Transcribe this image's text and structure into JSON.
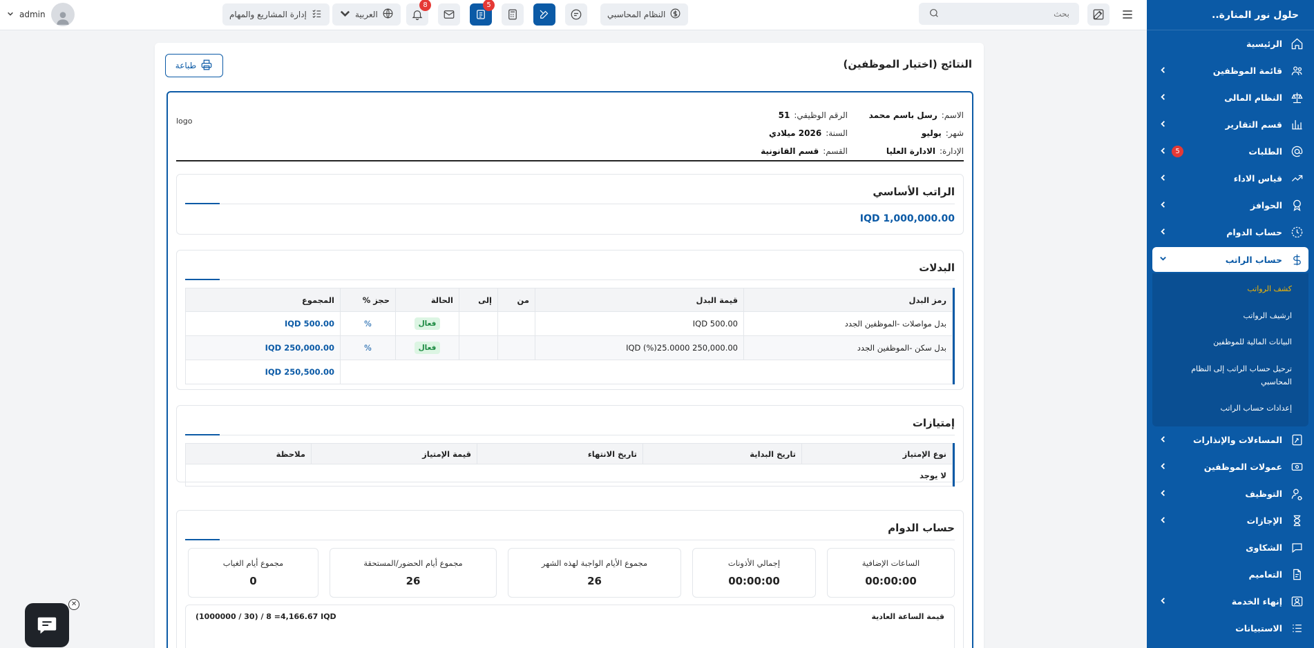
{
  "sidebar": {
    "brand": "حلول نور المنارة..",
    "items": [
      {
        "label": "الرئيسية",
        "icon": "home-icon",
        "chevron": false
      },
      {
        "label": "قائمة الموظفين",
        "icon": "users-icon",
        "chevron": true
      },
      {
        "label": "النظام المالى",
        "icon": "scale-icon",
        "chevron": true
      },
      {
        "label": "قسم التقارير",
        "icon": "chart-icon",
        "chevron": true
      },
      {
        "label": "الطلبات",
        "icon": "at-icon",
        "chevron": true,
        "badge": "5"
      },
      {
        "label": "قياس الاداء",
        "icon": "trend-icon",
        "chevron": true
      },
      {
        "label": "الحوافز",
        "icon": "award-icon",
        "chevron": true
      },
      {
        "label": "حساب الدوام",
        "icon": "clock-icon",
        "chevron": true
      }
    ],
    "active": {
      "label": "حساب الراتب",
      "icon": "dollar-icon"
    },
    "subitems": [
      "كشف الرواتب",
      "ارشيف الرواتب",
      "البيانات المالية للموظفين",
      "ترحيل حساب الراتب إلى النظام المحاسبي",
      "إعدادات حساب الراتب"
    ],
    "items_after": [
      {
        "label": "المساءلات والإنذارات",
        "icon": "gavel-icon",
        "chevron": true
      },
      {
        "label": "عمولات الموظفين",
        "icon": "cash-icon",
        "chevron": true
      },
      {
        "label": "التوظيف",
        "icon": "user-search-icon",
        "chevron": true
      },
      {
        "label": "الإجازات",
        "icon": "hourglass-icon",
        "chevron": true
      },
      {
        "label": "الشكاوى",
        "icon": "chat-icon",
        "chevron": false
      },
      {
        "label": "التعاميم",
        "icon": "doc-icon",
        "chevron": false
      },
      {
        "label": "إنهاء الخدمة",
        "icon": "user-x-icon",
        "chevron": true
      },
      {
        "label": "الاستبيانات",
        "icon": "list-icon",
        "chevron": false
      }
    ]
  },
  "topbar": {
    "search_placeholder": "بحث",
    "accounting_label": "النظام المحاسبي",
    "language_label": "العربية",
    "projects_label": "إدارة المشاريع والمهام",
    "user_name": "admin",
    "notif_count": "8",
    "tasks_count": "5"
  },
  "page": {
    "title": "النتائج (اختيار الموظفين)",
    "print_label": "طباعة"
  },
  "employee": {
    "name_label": "الاسم:",
    "name": "رسل باسم محمد",
    "id_label": "الرقم الوظيفي:",
    "id": "51",
    "month_label": "شهر:",
    "month": "يوليو",
    "year_label": "السنة:",
    "year": "2026 ميلادي",
    "admin_label": "الإدارة:",
    "admin": "الادارة العليا",
    "dept_label": "القسم:",
    "dept": "قسم القانونية",
    "logo_alt": "logo"
  },
  "basic_salary": {
    "title": "الراتب الأساسي",
    "amount": "1,000,000.00 IQD"
  },
  "allowances": {
    "title": "البدلات",
    "headers": [
      "رمز البدل",
      "قيمة البدل",
      "من",
      "إلى",
      "الحالة",
      "حجز %",
      "المجموع"
    ],
    "rows": [
      {
        "code": "بدل مواصلات -الموظفين الجدد",
        "value": "500.00 IQD",
        "from": "",
        "to": "",
        "status": "فعال",
        "pct": "%",
        "total": "500.00 IQD"
      },
      {
        "code": "بدل سكن -الموظفين الجدد",
        "value": "250,000.00 IQD (%)25.0000",
        "from": "",
        "to": "",
        "status": "فعال",
        "pct": "%",
        "total": "250,000.00 IQD"
      }
    ],
    "grand_total": "250,500.00 IQD"
  },
  "privileges": {
    "title": "إمتيازات",
    "headers": [
      "نوع الإمتياز",
      "تاريخ البداية",
      "تاريخ الانتهاء",
      "قيمة الإمتياز",
      "ملاحظة"
    ],
    "empty": "لا يوجد"
  },
  "attendance": {
    "title": "حساب الدوام",
    "stats": [
      {
        "label": "الساعات الإضافية",
        "value": "00:00:00"
      },
      {
        "label": "إجمالي الأذونات",
        "value": "00:00:00"
      },
      {
        "label": "مجموع الأيام الواجبة لهذه الشهر",
        "value": "26"
      },
      {
        "label": "مجموع أيام الحضور/المستحقة",
        "value": "26"
      },
      {
        "label": "مجموع أيام الغياب",
        "value": "0"
      }
    ],
    "hour_label": "قيمة الساعة العادية",
    "hour_value": "(1000000 / 30) / 8 =4,166.67 IQD"
  },
  "colors": {
    "primary": "#0b5aa6",
    "badge": "#e53935",
    "accent_current": "#f5b700"
  }
}
